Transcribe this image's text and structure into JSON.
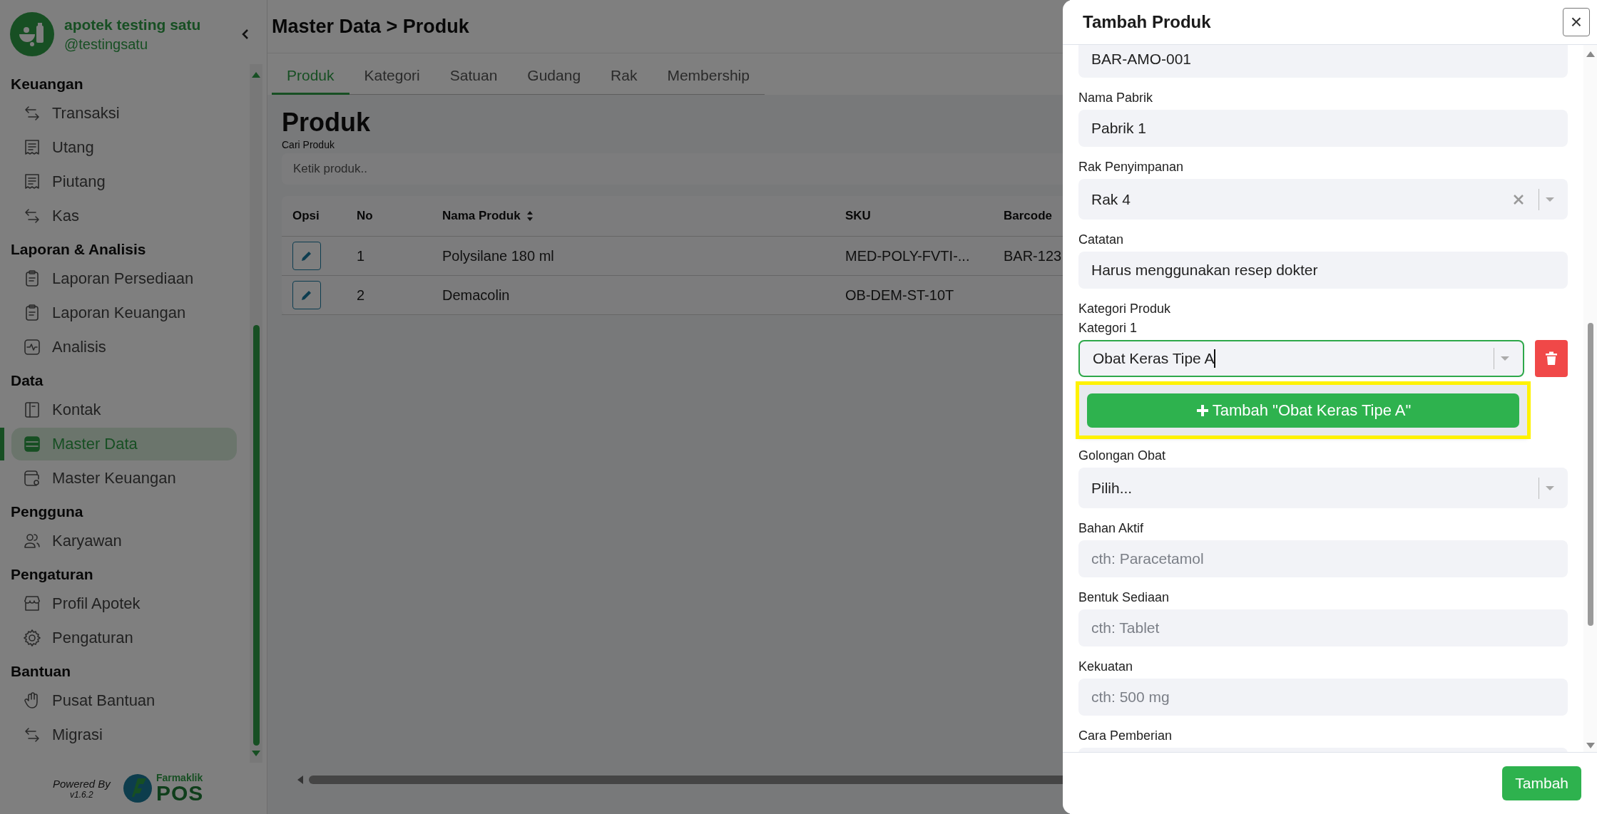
{
  "app": {
    "name": "apotek testing satu",
    "handle": "@testingsatu"
  },
  "sidebar": {
    "sections": [
      {
        "title": "Keuangan",
        "items": [
          {
            "label": "Transaksi",
            "kind": "arrows",
            "selected": false
          },
          {
            "label": "Utang",
            "kind": "receipt",
            "selected": false
          },
          {
            "label": "Piutang",
            "kind": "receipt",
            "selected": false
          },
          {
            "label": "Kas",
            "kind": "arrows",
            "selected": false
          }
        ]
      },
      {
        "title": "Laporan & Analisis",
        "items": [
          {
            "label": "Laporan Persediaan",
            "kind": "clipboard",
            "selected": false
          },
          {
            "label": "Laporan Keuangan",
            "kind": "clipboard",
            "selected": false
          },
          {
            "label": "Analisis",
            "kind": "pulse",
            "selected": false
          }
        ]
      },
      {
        "title": "Data",
        "items": [
          {
            "label": "Kontak",
            "kind": "book",
            "selected": false
          },
          {
            "label": "Master Data",
            "kind": "database",
            "selected": true
          },
          {
            "label": "Master Keuangan",
            "kind": "wallet",
            "selected": false
          }
        ]
      },
      {
        "title": "Pengguna",
        "items": [
          {
            "label": "Karyawan",
            "kind": "users",
            "selected": false
          }
        ]
      },
      {
        "title": "Pengaturan",
        "items": [
          {
            "label": "Profil Apotek",
            "kind": "store",
            "selected": false
          },
          {
            "label": "Pengaturan",
            "kind": "gear",
            "selected": false
          }
        ]
      },
      {
        "title": "Bantuan",
        "items": [
          {
            "label": "Pusat Bantuan",
            "kind": "hand",
            "selected": false
          },
          {
            "label": "Migrasi",
            "kind": "arrows",
            "selected": false
          }
        ]
      }
    ],
    "footer": {
      "powered_by": "Powered By",
      "version": "v1.6.2",
      "brand": "Farmaklik",
      "product": "POS"
    }
  },
  "breadcrumb": "Master Data > Produk",
  "tabs": [
    {
      "label": "Produk",
      "selected": true
    },
    {
      "label": "Kategori",
      "selected": false
    },
    {
      "label": "Satuan",
      "selected": false
    },
    {
      "label": "Gudang",
      "selected": false
    },
    {
      "label": "Rak",
      "selected": false
    },
    {
      "label": "Membership",
      "selected": false
    }
  ],
  "page_title": "Produk",
  "search": {
    "label": "Cari Produk",
    "placeholder": "Ketik produk.."
  },
  "table": {
    "columns": [
      {
        "label": "Opsi",
        "sortable": false
      },
      {
        "label": "No",
        "sortable": false
      },
      {
        "label": "Nama Produk",
        "sortable": true
      },
      {
        "label": "SKU",
        "sortable": false
      },
      {
        "label": "Barcode",
        "sortable": false
      }
    ],
    "rows": [
      {
        "no": "1",
        "name": "Polysilane 180 ml",
        "sku": "MED-POLY-FVTI-...",
        "barcode": "BAR-123"
      },
      {
        "no": "2",
        "name": "Demacolin",
        "sku": "OB-DEM-ST-10T"
      }
    ]
  },
  "modal": {
    "title": "Tambah Produk",
    "close": "×",
    "fields": [
      {
        "kind": "input",
        "value": "BAR-AMO-001"
      },
      {
        "kind": "input",
        "label": "Nama Pabrik",
        "value": "Pabrik 1"
      },
      {
        "kind": "select",
        "label": "Rak Penyimpanan",
        "value": "Rak 4",
        "clearable": true
      },
      {
        "kind": "input",
        "label": "Catatan",
        "value": "Harus menggunakan resep dokter"
      },
      {
        "kind": "category",
        "label": "Kategori Produk",
        "sublabel": "Kategori 1",
        "value": "Obat Keras Tipe A",
        "focused": true,
        "option": {
          "label": "Tambah \"Obat Keras Tipe A\"",
          "highlighted": true
        }
      },
      {
        "kind": "select",
        "label": "Golongan Obat",
        "value": "Pilih...",
        "clearable": false
      },
      {
        "kind": "input",
        "label": "Bahan Aktif",
        "placeholder": "cth: Paracetamol"
      },
      {
        "kind": "input",
        "label": "Bentuk Sediaan",
        "placeholder": "cth: Tablet"
      },
      {
        "kind": "input",
        "label": "Kekuatan",
        "placeholder": "cth: 500 mg"
      },
      {
        "kind": "input",
        "label": "Cara Pemberian"
      }
    ],
    "submit": "Tambah"
  }
}
